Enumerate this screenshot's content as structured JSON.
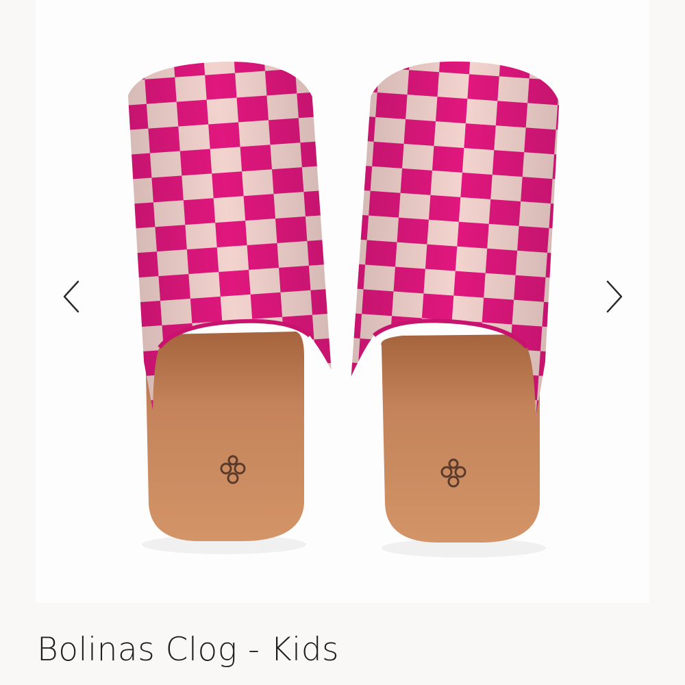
{
  "product": {
    "title": "Bolinas Clog - Kids",
    "image_alt": "Pink and cream checkered crochet clogs with tan footbed"
  },
  "gallery": {
    "prev_icon": "chevron-left-icon",
    "next_icon": "chevron-right-icon"
  },
  "colors": {
    "pink": "#e0177e",
    "cream": "#f3d3ce",
    "sole": "#c07c4f",
    "text": "#1f1f1f"
  }
}
